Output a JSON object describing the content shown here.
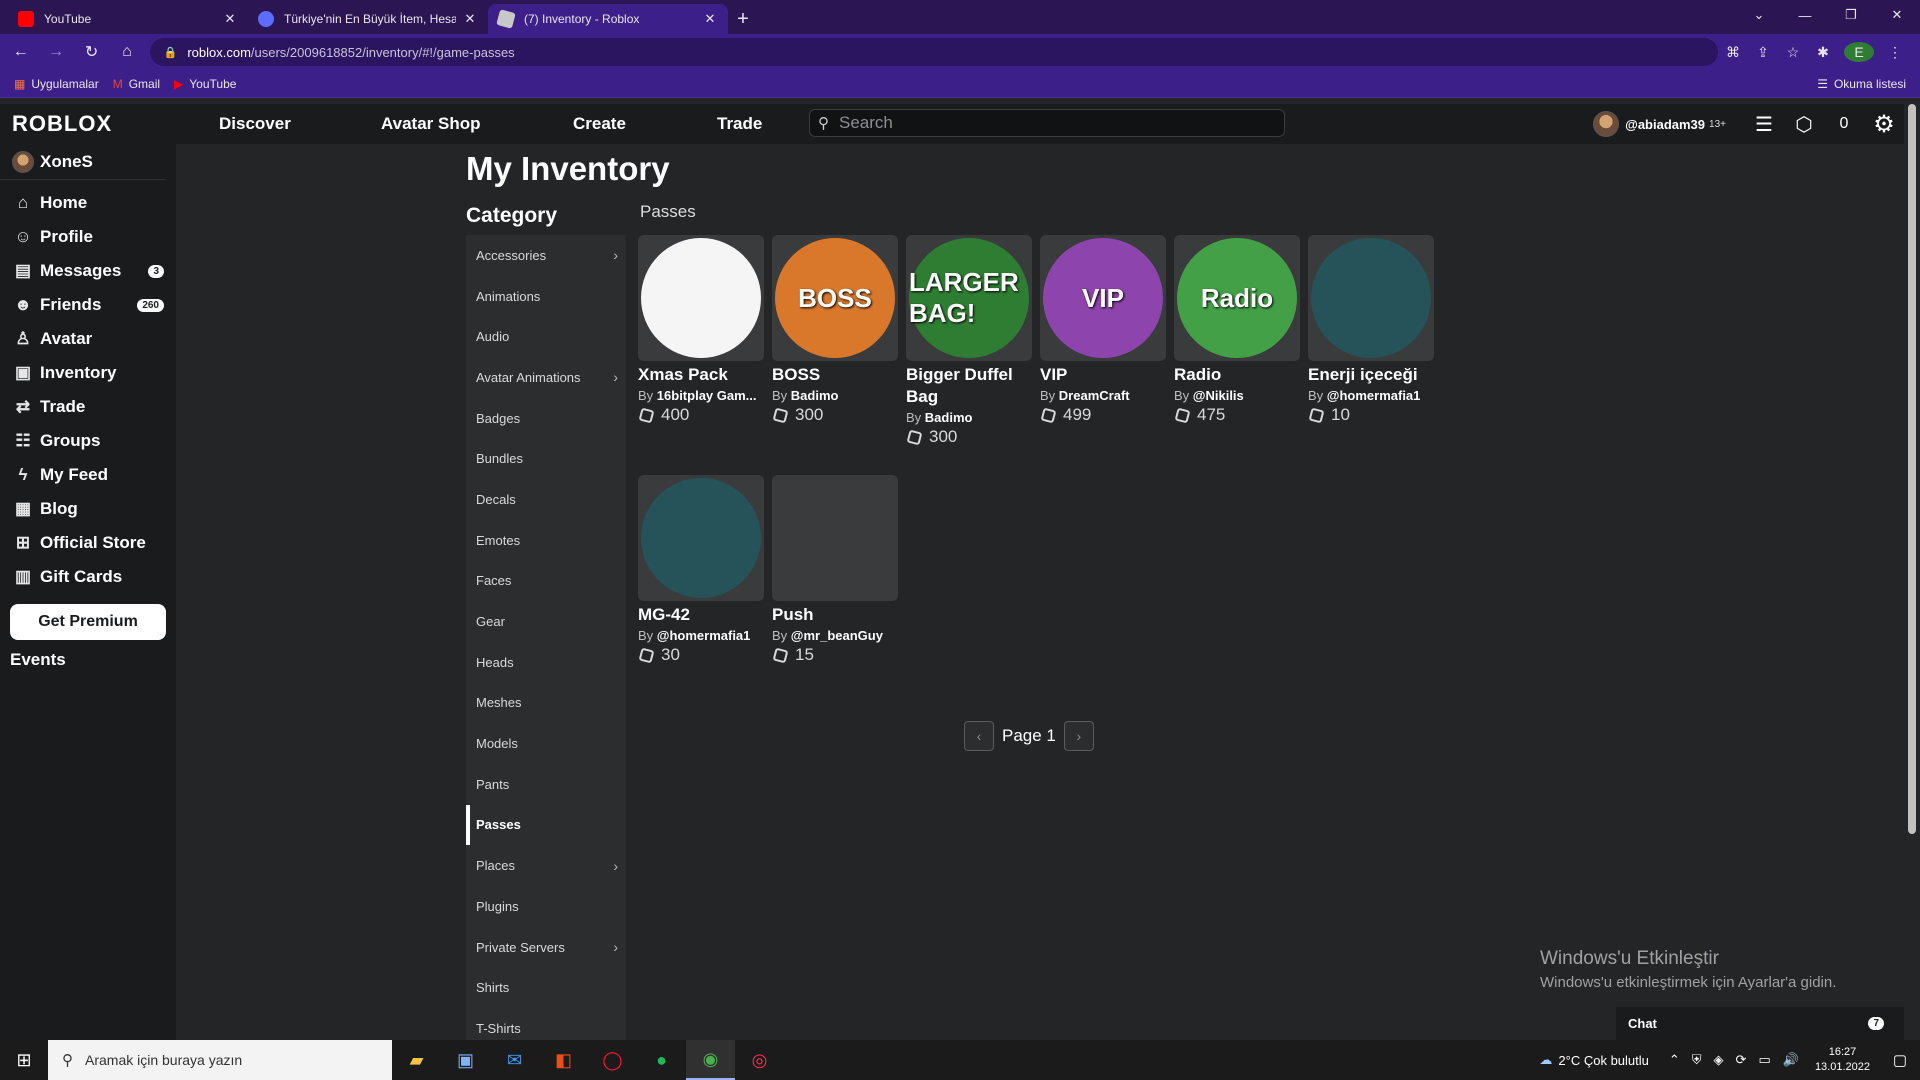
{
  "browser": {
    "tabs": [
      {
        "title": "YouTube",
        "favicon_color": "#ff0000",
        "active": false
      },
      {
        "title": "Türkiye'nin En Büyük İtem, Hesap",
        "favicon_color": "#5b6cff",
        "active": false
      },
      {
        "title": "(7) Inventory - Roblox",
        "favicon_color": "#c8c8c8",
        "active": true
      }
    ],
    "url_host": "roblox.com",
    "url_path": "/users/2009618852/inventory/#!/game-passes",
    "profile_letter": "E",
    "bookmarks": [
      {
        "label": "Uygulamalar",
        "icon": "grid-icon"
      },
      {
        "label": "Gmail",
        "icon": "gmail-icon"
      },
      {
        "label": "YouTube",
        "icon": "youtube-icon"
      }
    ],
    "reading_list": "Okuma listesi"
  },
  "roblox": {
    "logo": "ROBLOX",
    "nav": [
      "Discover",
      "Avatar Shop",
      "Create",
      "Trade"
    ],
    "search_placeholder": "Search",
    "username": "@abiadam39",
    "age_label": "13+",
    "robux": "0"
  },
  "sidebar": {
    "display_name": "XoneS",
    "items": [
      {
        "label": "Home",
        "icon": "home-icon",
        "badge": ""
      },
      {
        "label": "Profile",
        "icon": "profile-icon",
        "badge": ""
      },
      {
        "label": "Messages",
        "icon": "messages-icon",
        "badge": "3"
      },
      {
        "label": "Friends",
        "icon": "friends-icon",
        "badge": "260"
      },
      {
        "label": "Avatar",
        "icon": "avatar-icon",
        "badge": ""
      },
      {
        "label": "Inventory",
        "icon": "inventory-icon",
        "badge": ""
      },
      {
        "label": "Trade",
        "icon": "trade-icon",
        "badge": ""
      },
      {
        "label": "Groups",
        "icon": "groups-icon",
        "badge": ""
      },
      {
        "label": "My Feed",
        "icon": "feed-icon",
        "badge": ""
      },
      {
        "label": "Blog",
        "icon": "blog-icon",
        "badge": ""
      },
      {
        "label": "Official Store",
        "icon": "store-icon",
        "badge": ""
      },
      {
        "label": "Gift Cards",
        "icon": "giftcard-icon",
        "badge": ""
      }
    ],
    "premium_label": "Get Premium",
    "events_label": "Events"
  },
  "main": {
    "title": "My Inventory",
    "category_title": "Category",
    "section_label": "Passes",
    "categories": [
      {
        "label": "Accessories",
        "chevron": true,
        "active": false
      },
      {
        "label": "Animations",
        "chevron": false,
        "active": false
      },
      {
        "label": "Audio",
        "chevron": false,
        "active": false
      },
      {
        "label": "Avatar Animations",
        "chevron": true,
        "active": false
      },
      {
        "label": "Badges",
        "chevron": false,
        "active": false
      },
      {
        "label": "Bundles",
        "chevron": false,
        "active": false
      },
      {
        "label": "Decals",
        "chevron": false,
        "active": false
      },
      {
        "label": "Emotes",
        "chevron": false,
        "active": false
      },
      {
        "label": "Faces",
        "chevron": false,
        "active": false
      },
      {
        "label": "Gear",
        "chevron": false,
        "active": false
      },
      {
        "label": "Heads",
        "chevron": false,
        "active": false
      },
      {
        "label": "Meshes",
        "chevron": false,
        "active": false
      },
      {
        "label": "Models",
        "chevron": false,
        "active": false
      },
      {
        "label": "Pants",
        "chevron": false,
        "active": false
      },
      {
        "label": "Passes",
        "chevron": false,
        "active": true
      },
      {
        "label": "Places",
        "chevron": true,
        "active": false
      },
      {
        "label": "Plugins",
        "chevron": false,
        "active": false
      },
      {
        "label": "Private Servers",
        "chevron": true,
        "active": false
      },
      {
        "label": "Shirts",
        "chevron": false,
        "active": false
      },
      {
        "label": "T-Shirts",
        "chevron": false,
        "active": false
      }
    ],
    "items": [
      {
        "name": "Xmas Pack",
        "by": "By",
        "creator": "16bitplay Gam...",
        "price": "400",
        "thumb_text": "",
        "bg": "#f5f5f5",
        "fg": "#c2185b"
      },
      {
        "name": "BOSS",
        "by": "By",
        "creator": "Badimo",
        "price": "300",
        "thumb_text": "BOSS",
        "bg": "#d9772b",
        "fg": "#fff"
      },
      {
        "name": "Bigger Duffel Bag",
        "by": "By",
        "creator": "Badimo",
        "price": "300",
        "thumb_text": "LARGER BAG!",
        "bg": "#2e7d32",
        "fg": "#fff"
      },
      {
        "name": "VIP",
        "by": "By",
        "creator": "DreamCraft",
        "price": "499",
        "thumb_text": "VIP",
        "bg": "#8e44ad",
        "fg": "#fff"
      },
      {
        "name": "Radio",
        "by": "By",
        "creator": "@Nikilis",
        "price": "475",
        "thumb_text": "Radio",
        "bg": "#43a047",
        "fg": "#fff"
      },
      {
        "name": "Enerji içeceği",
        "by": "By",
        "creator": "@homermafia1",
        "price": "10",
        "thumb_text": "",
        "bg": "#26535a",
        "fg": "#7cff4f"
      },
      {
        "name": "MG-42",
        "by": "By",
        "creator": "@homermafia1",
        "price": "30",
        "thumb_text": "",
        "bg": "#26535a",
        "fg": "#fff"
      },
      {
        "name": "Push",
        "by": "By",
        "creator": "@mr_beanGuy",
        "price": "15",
        "thumb_text": "",
        "bg": "#393b3d",
        "fg": "#e8d21a"
      }
    ],
    "page_label": "Page 1"
  },
  "overlay": {
    "activate_title": "Windows'u Etkinleştir",
    "activate_sub": "Windows'u etkinleştirmek için Ayarlar'a gidin.",
    "chat_label": "Chat",
    "chat_badge": "7"
  },
  "taskbar": {
    "search_placeholder": "Aramak için buraya yazın",
    "weather": "2°C  Çok bulutlu",
    "time": "16:27",
    "date": "13.01.2022"
  }
}
